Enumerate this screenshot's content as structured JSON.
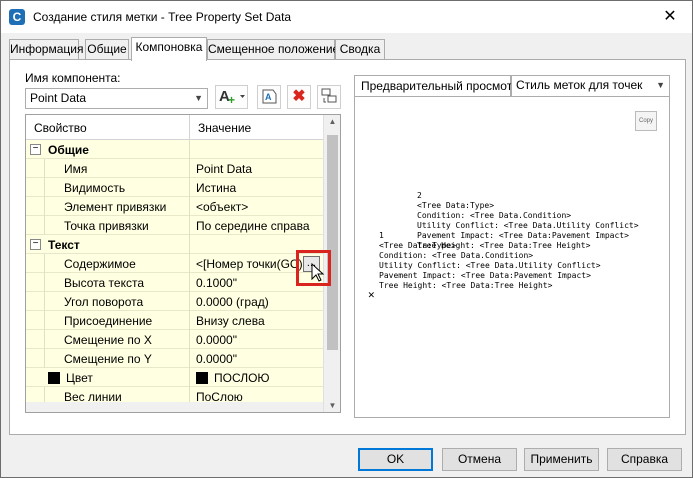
{
  "window": {
    "title": "Создание стиля метки - Tree Property Set Data",
    "close_glyph": "✕"
  },
  "tabs": [
    {
      "label": "Информация",
      "active": false
    },
    {
      "label": "Общие",
      "active": false
    },
    {
      "label": "Компоновка",
      "active": true
    },
    {
      "label": "Смещенное положение",
      "active": false
    },
    {
      "label": "Сводка",
      "active": false
    }
  ],
  "layout_tab": {
    "component_label": "Имя компонента:",
    "component_value": "Point Data",
    "toolbar": {
      "add_component": "A+",
      "copy_component": "copy",
      "delete_component": "✖",
      "draw_order": "order"
    },
    "grid": {
      "col_property": "Свойство",
      "col_value": "Значение",
      "rows": [
        {
          "type": "group",
          "label": "Общие"
        },
        {
          "type": "prop",
          "label": "Имя",
          "value": "Point Data"
        },
        {
          "type": "prop",
          "label": "Видимость",
          "value": "Истина"
        },
        {
          "type": "prop",
          "label": "Элемент привязки",
          "value": "<объект>"
        },
        {
          "type": "prop",
          "label": "Точка привязки",
          "value": "По середине справа"
        },
        {
          "type": "group",
          "label": "Текст"
        },
        {
          "type": "prop",
          "label": "Содержимое",
          "value": "<[Номер точки(GC)"
        },
        {
          "type": "prop",
          "label": "Высота текста",
          "value": "0.1000\""
        },
        {
          "type": "prop",
          "label": "Угол поворота",
          "value": "0.0000 (град)"
        },
        {
          "type": "prop",
          "label": "Присоединение",
          "value": "Внизу слева"
        },
        {
          "type": "prop",
          "label": "Смещение по X",
          "value": "0.0000\""
        },
        {
          "type": "prop",
          "label": "Смещение по Y",
          "value": "0.0000\""
        },
        {
          "type": "color",
          "label": "Цвет",
          "value": "ПОСЛОЮ"
        },
        {
          "type": "prop",
          "label": "Вес линии",
          "value": "ПоСлою"
        }
      ],
      "ellipsis": "..."
    }
  },
  "preview": {
    "tab_label": "Предварительный просмотр",
    "style_select": "Стиль меток для точек",
    "copy_btn": "Copy",
    "text_block_1": "2\n<Tree Data:Type>\nCondition: <Tree Data.Condition>\nUtility Conflict: <Tree Data.Utility Conflict>\nPavement Impact: <Tree Data:Pavement Impact>\nTree Height: <Tree Data:Tree Height>",
    "text_block_2": "1\n<Tree Data:Type>\nCondition: <Tree Data.Condition>\nUtility Conflict: <Tree Data.Utility Conflict>\nPavement Impact: <Tree Data:Pavement Impact>\nTree Height: <Tree Data:Tree Height>",
    "marker": "✕"
  },
  "buttons": {
    "ok": "OK",
    "cancel": "Отмена",
    "apply": "Применить",
    "help": "Справка"
  },
  "colors": {
    "accent": "#0078d7",
    "highlight_box": "#d9251d",
    "grid_row_bg": "#ffffe1",
    "delete_icon": "#d9251d",
    "add_icon": "#2a9d2a"
  }
}
